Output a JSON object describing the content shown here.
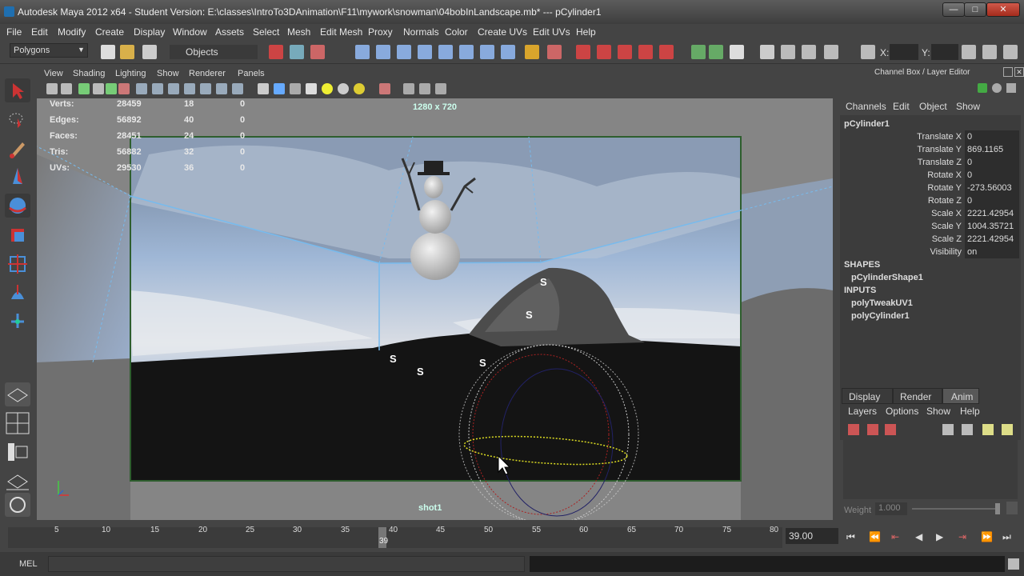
{
  "window": {
    "title": "Autodesk Maya 2012 x64 - Student Version: E:\\classes\\IntroTo3DAnimation\\F11\\mywork\\snowman\\04bobInLandscape.mb*   ---   pCylinder1",
    "minimize": "—",
    "maximize": "□",
    "close": "✕"
  },
  "menubar": [
    "File",
    "Edit",
    "Modify",
    "Create",
    "Display",
    "Window",
    "Assets",
    "Select",
    "Mesh",
    "Edit Mesh",
    "Proxy",
    "Normals",
    "Color",
    "Create UVs",
    "Edit UVs",
    "Help"
  ],
  "toolbar": {
    "menuset": "Polygons",
    "selection_mode": "Objects",
    "x_label": "X:",
    "y_label": "Y:"
  },
  "viewport": {
    "menu": [
      "View",
      "Shading",
      "Lighting",
      "Show",
      "Renderer",
      "Panels"
    ],
    "resolution": "1280 x 720",
    "camera": "shot1",
    "hud": {
      "rows": [
        {
          "label": "Verts:",
          "a": "28459",
          "b": "18",
          "c": "0"
        },
        {
          "label": "Edges:",
          "a": "56892",
          "b": "40",
          "c": "0"
        },
        {
          "label": "Faces:",
          "a": "28451",
          "b": "24",
          "c": "0"
        },
        {
          "label": "Tris:",
          "a": "56882",
          "b": "32",
          "c": "0"
        },
        {
          "label": "UVs:",
          "a": "29530",
          "b": "36",
          "c": "0"
        }
      ]
    },
    "ornaments": [
      "S",
      "S",
      "S",
      "S",
      "S"
    ]
  },
  "channelbox": {
    "header": "Channel Box / Layer Editor",
    "menu": [
      "Channels",
      "Edit",
      "Object",
      "Show"
    ],
    "object": "pCylinder1",
    "attributes": [
      {
        "name": "Translate X",
        "value": "0"
      },
      {
        "name": "Translate Y",
        "value": "869.1165"
      },
      {
        "name": "Translate Z",
        "value": "0"
      },
      {
        "name": "Rotate X",
        "value": "0"
      },
      {
        "name": "Rotate Y",
        "value": "-273.56003"
      },
      {
        "name": "Rotate Z",
        "value": "0"
      },
      {
        "name": "Scale X",
        "value": "2221.42954"
      },
      {
        "name": "Scale Y",
        "value": "1004.35721"
      },
      {
        "name": "Scale Z",
        "value": "2221.42954"
      },
      {
        "name": "Visibility",
        "value": "on"
      }
    ],
    "shapes_header": "SHAPES",
    "shape": "pCylinderShape1",
    "inputs_header": "INPUTS",
    "inputs": [
      "polyTweakUV1",
      "polyCylinder1"
    ]
  },
  "layereditor": {
    "tabs": [
      "Display",
      "Render",
      "Anim"
    ],
    "active_tab": "Anim",
    "menu": [
      "Layers",
      "Options",
      "Show",
      "Help"
    ],
    "weight_label": "Weight",
    "weight_value": "1.000"
  },
  "timeline": {
    "ticks": [
      "5",
      "10",
      "15",
      "20",
      "25",
      "30",
      "35",
      "40",
      "45",
      "50",
      "55",
      "60",
      "65",
      "70",
      "75",
      "80"
    ],
    "current_frame": "39",
    "current_field": "39.00"
  },
  "cmdline": {
    "label": "MEL"
  }
}
